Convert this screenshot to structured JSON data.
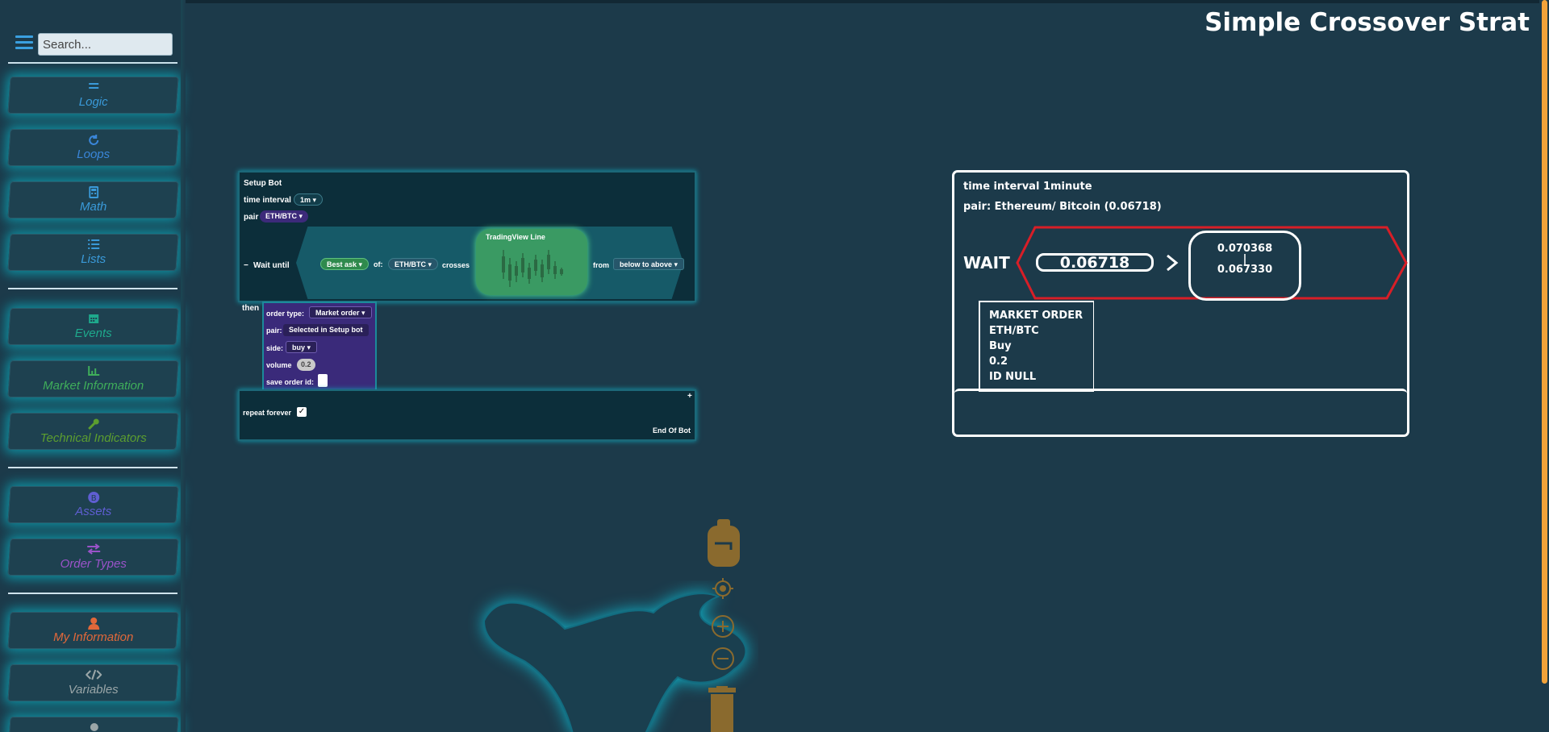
{
  "app": {
    "title": "Simple Crossover Strat"
  },
  "search": {
    "placeholder": "Search..."
  },
  "sidebar": {
    "categories": [
      {
        "label": "Logic",
        "icon": "equals-icon",
        "color": "#3a9ad9"
      },
      {
        "label": "Loops",
        "icon": "refresh-icon",
        "color": "#3a86d9"
      },
      {
        "label": "Math",
        "icon": "calculator-icon",
        "color": "#3a9ad9"
      },
      {
        "label": "Lists",
        "icon": "list-icon",
        "color": "#3a9ad9"
      },
      {
        "label": "Events",
        "icon": "calendar-icon",
        "color": "#1ea98c"
      },
      {
        "label": "Market Information",
        "icon": "chart-icon",
        "color": "#3fae5a"
      },
      {
        "label": "Technical Indicators",
        "icon": "wrench-icon",
        "color": "#5c9e2f"
      },
      {
        "label": "Assets",
        "icon": "bitcoin-icon",
        "color": "#5f5ed2"
      },
      {
        "label": "Order Types",
        "icon": "exchange-icon",
        "color": "#9a53c9"
      },
      {
        "label": "My Information",
        "icon": "user-icon",
        "color": "#e2683a"
      },
      {
        "label": "Variables",
        "icon": "code-icon",
        "color": "#9aa6a8"
      }
    ]
  },
  "workspace": {
    "setup_title": "Setup Bot",
    "time_interval_label": "time interval",
    "time_interval_value": "1m",
    "pair_label": "pair",
    "pair_value": "ETH/BTC",
    "collapse_symbol": "−",
    "wait_label": "Wait until",
    "price_source": "Best ask",
    "of_label": "of:",
    "of_pair": "ETH/BTC",
    "crosses_label": "crosses",
    "tv_line_label": "TradingView Line",
    "from_label": "from",
    "direction": "below to above",
    "then_label": "then",
    "order": {
      "type_label": "order type:",
      "type_value": "Market order",
      "pair_label": "pair:",
      "pair_value": "Selected in Setup bot",
      "side_label": "side:",
      "side_value": "buy",
      "volume_label": "volume",
      "volume_value": "0.2",
      "save_label": "save order id:"
    },
    "plus_symbol": "+",
    "repeat_label": "repeat forever",
    "repeat_checked": "✓",
    "end_label": "End Of Bot"
  },
  "preview": {
    "interval_text": "time interval 1minute",
    "pair_text": "pair: Ethereum/ Bitcoin (0.06718)",
    "wait_text": "WAIT",
    "current_value": "0.06718",
    "operator": ">",
    "range_high": "0.070368",
    "range_sep": "|",
    "range_low": "0.067330",
    "order_lines": [
      "MARKET ORDER",
      "ETH/BTC",
      "Buy",
      "0.2",
      "ID NULL"
    ]
  },
  "colors": {
    "accent": "#3aa0e0",
    "scrollbar": "#f2a33a",
    "tool_icons": "#8a6a2e",
    "alert_red": "#d81e27"
  }
}
